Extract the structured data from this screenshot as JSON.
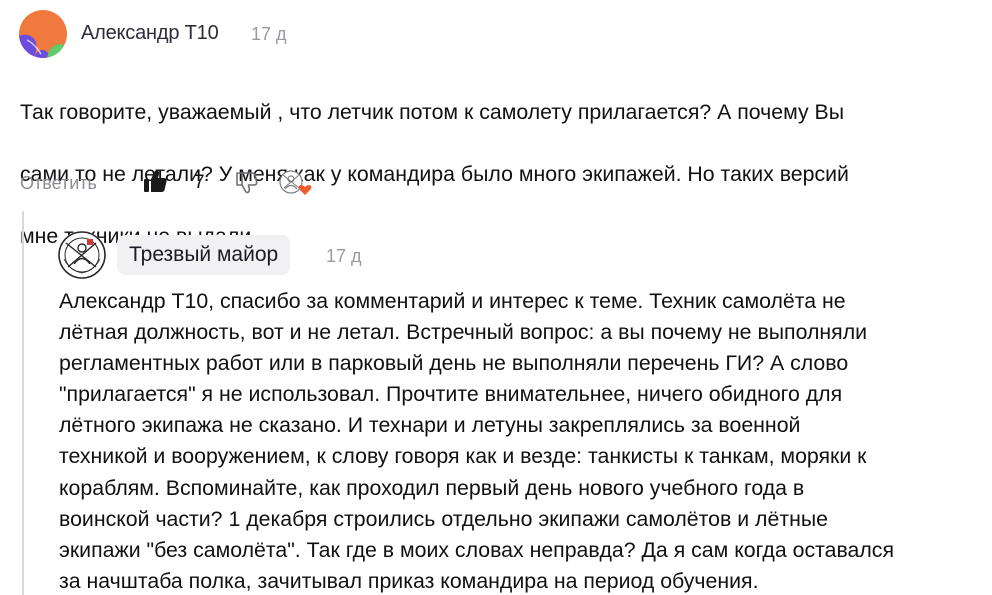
{
  "comment1": {
    "author": "Александр Т10",
    "date": "17 д",
    "text_lines": [
      "Так говорите, уважаемый , что летчик потом к самолету прилагается? А почему Вы",
      "сами то не летали? У меня как у командира было много экипажей. Но таких версий",
      "мне техники не выдали."
    ],
    "actions": {
      "reply_label": "Ответить",
      "like_count": "7"
    }
  },
  "comment2": {
    "author": "Трезвый майор",
    "date": "17 д",
    "text_lines": [
      "Александр Т10, спасибо за комментарий и интерес к теме. Техник самолёта не",
      "лётная должность, вот и не летал. Встречный вопрос: а вы почему не выполняли",
      "регламентных работ или в парковый день не выполняли перечень ГИ? А слово",
      "\"прилагается\" я не использовал. Прочтите внимательнее, ничего обидного для",
      "лётного экипажа не сказано. И технари и летуны закреплялись за военной",
      "техникой и вооружением, к слову говоря как и везде: танкисты к танкам, моряки к",
      "кораблям. Вспоминайте, как проходил первый день нового учебного года в",
      "воинской части? 1 декабря строились отдельно экипажи самолётов и лётные",
      "экипажи \"без самолёта\". Так где в моих словах неправда? Да я сам когда оставался",
      "за начштаба полка, зачитывал приказ командира на период обучения."
    ]
  },
  "icons": {
    "like": "thumbs-up-filled-icon",
    "dislike": "thumbs-down-outline-icon",
    "author_liked": "author-heart-icon"
  },
  "colors": {
    "avatar_orange": "#F07A3E",
    "avatar_purple": "#6B4BE0",
    "avatar_green": "#5FCB6A",
    "heart": "#F25C2E",
    "muted_text": "#8C8C96"
  }
}
